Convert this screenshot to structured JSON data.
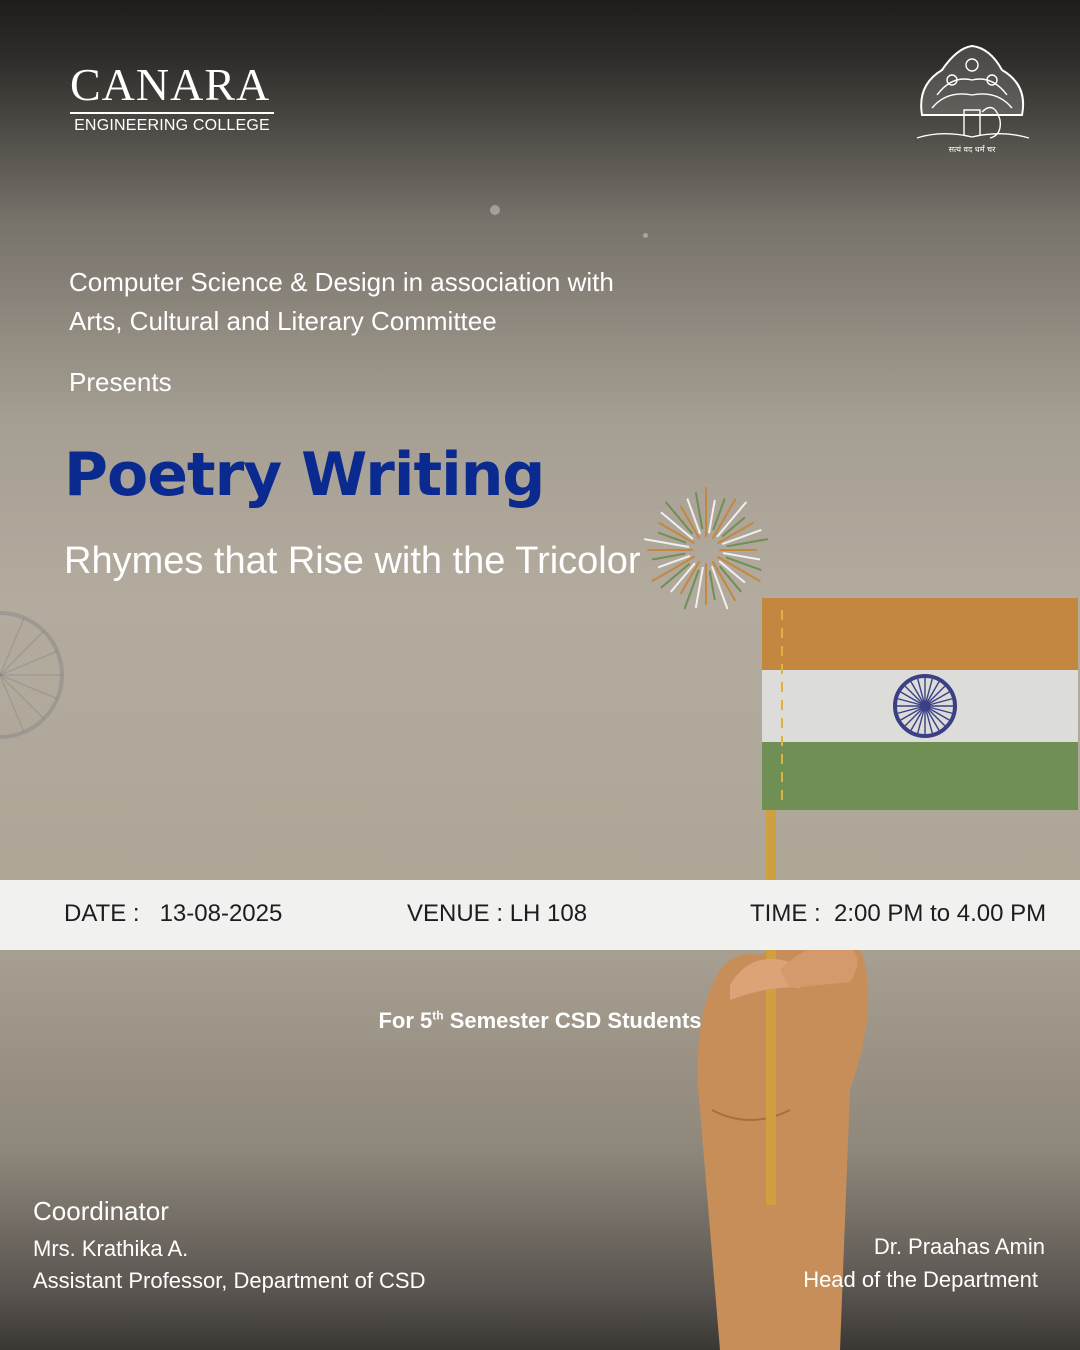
{
  "college": {
    "name": "CANARA",
    "subtitle": "ENGINEERING COLLEGE",
    "emblem_text": "सत्यं वद धर्मं चर"
  },
  "intro": {
    "line1": "Computer Science & Design in association with",
    "line2": "Arts, Cultural and Literary Committee",
    "presents": "Presents"
  },
  "event": {
    "title": "Poetry Writing",
    "tagline": "Rhymes that Rise with the Tricolor"
  },
  "details": {
    "date_label": "DATE :",
    "date_value": "13-08-2025",
    "venue_label": "VENUE :",
    "venue_value": "LH 108",
    "time_label": "TIME :",
    "time_value": "2:00 PM to 4.00 PM"
  },
  "audience": {
    "prefix": "For 5",
    "superscript": "th",
    "suffix": " Semester CSD Students"
  },
  "coordinator": {
    "label": "Coordinator",
    "name": "Mrs. Krathika A.",
    "role": "Assistant Professor, Department of CSD"
  },
  "hod": {
    "name": "Dr. Praahas Amin",
    "role": "Head of the Department"
  },
  "colors": {
    "title_blue": "#0b2a8f",
    "saffron": "#c4873f",
    "flag_white": "#dcdcd8",
    "flag_green": "#6f8f55",
    "chakra_navy": "#3b3f86"
  },
  "icons": [
    "ashoka-chakra-icon",
    "firework-icon",
    "indian-flag-icon",
    "college-emblem-icon"
  ]
}
